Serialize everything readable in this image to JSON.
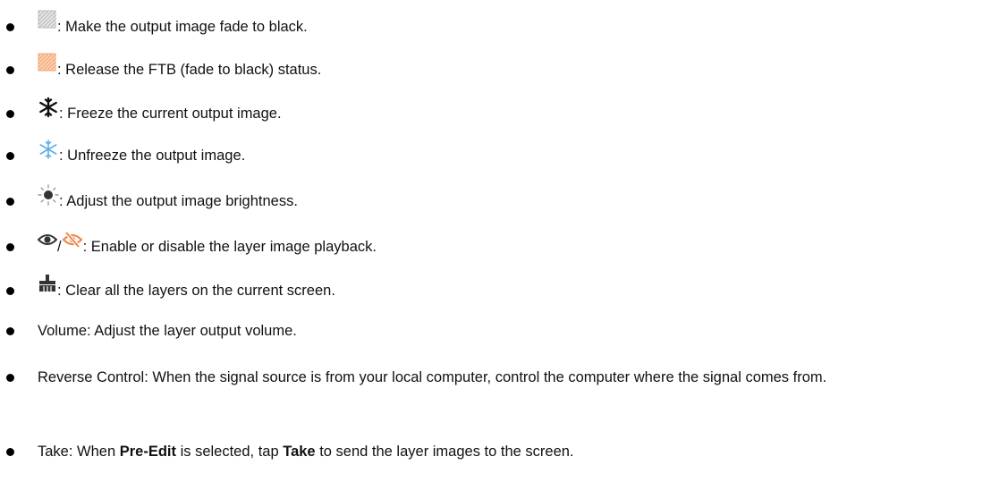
{
  "items": [
    {
      "icon": "fade-to-black-icon",
      "text": ": Make the output image fade to black."
    },
    {
      "icon": "release-ftb-icon",
      "text": ": Release the FTB (fade to black) status."
    },
    {
      "icon": "freeze-icon",
      "text": ": Freeze the current output image."
    },
    {
      "icon": "unfreeze-icon",
      "text": ": Unfreeze the output image."
    },
    {
      "icon": "brightness-icon",
      "text": ": Adjust the output image brightness."
    },
    {
      "icon": [
        "eye-icon",
        "eye-slash-icon"
      ],
      "separator": "/",
      "text": ": Enable or disable the layer image playback."
    },
    {
      "icon": "clear-layers-icon",
      "text": ": Clear all the layers on the current screen."
    },
    {
      "text": "Volume: Adjust the layer output volume."
    },
    {
      "text": "Reverse Control: When the signal source is from your local computer, control the computer where the signal comes from."
    },
    {
      "text_parts": [
        "Take: When ",
        "Pre-Edit",
        " is selected, tap ",
        "Take",
        " to send the layer images to the screen."
      ]
    }
  ],
  "colors": {
    "text": "#111111",
    "orange": "#f2884a",
    "blue": "#5aaee6",
    "gray": "#9a9a9a"
  }
}
